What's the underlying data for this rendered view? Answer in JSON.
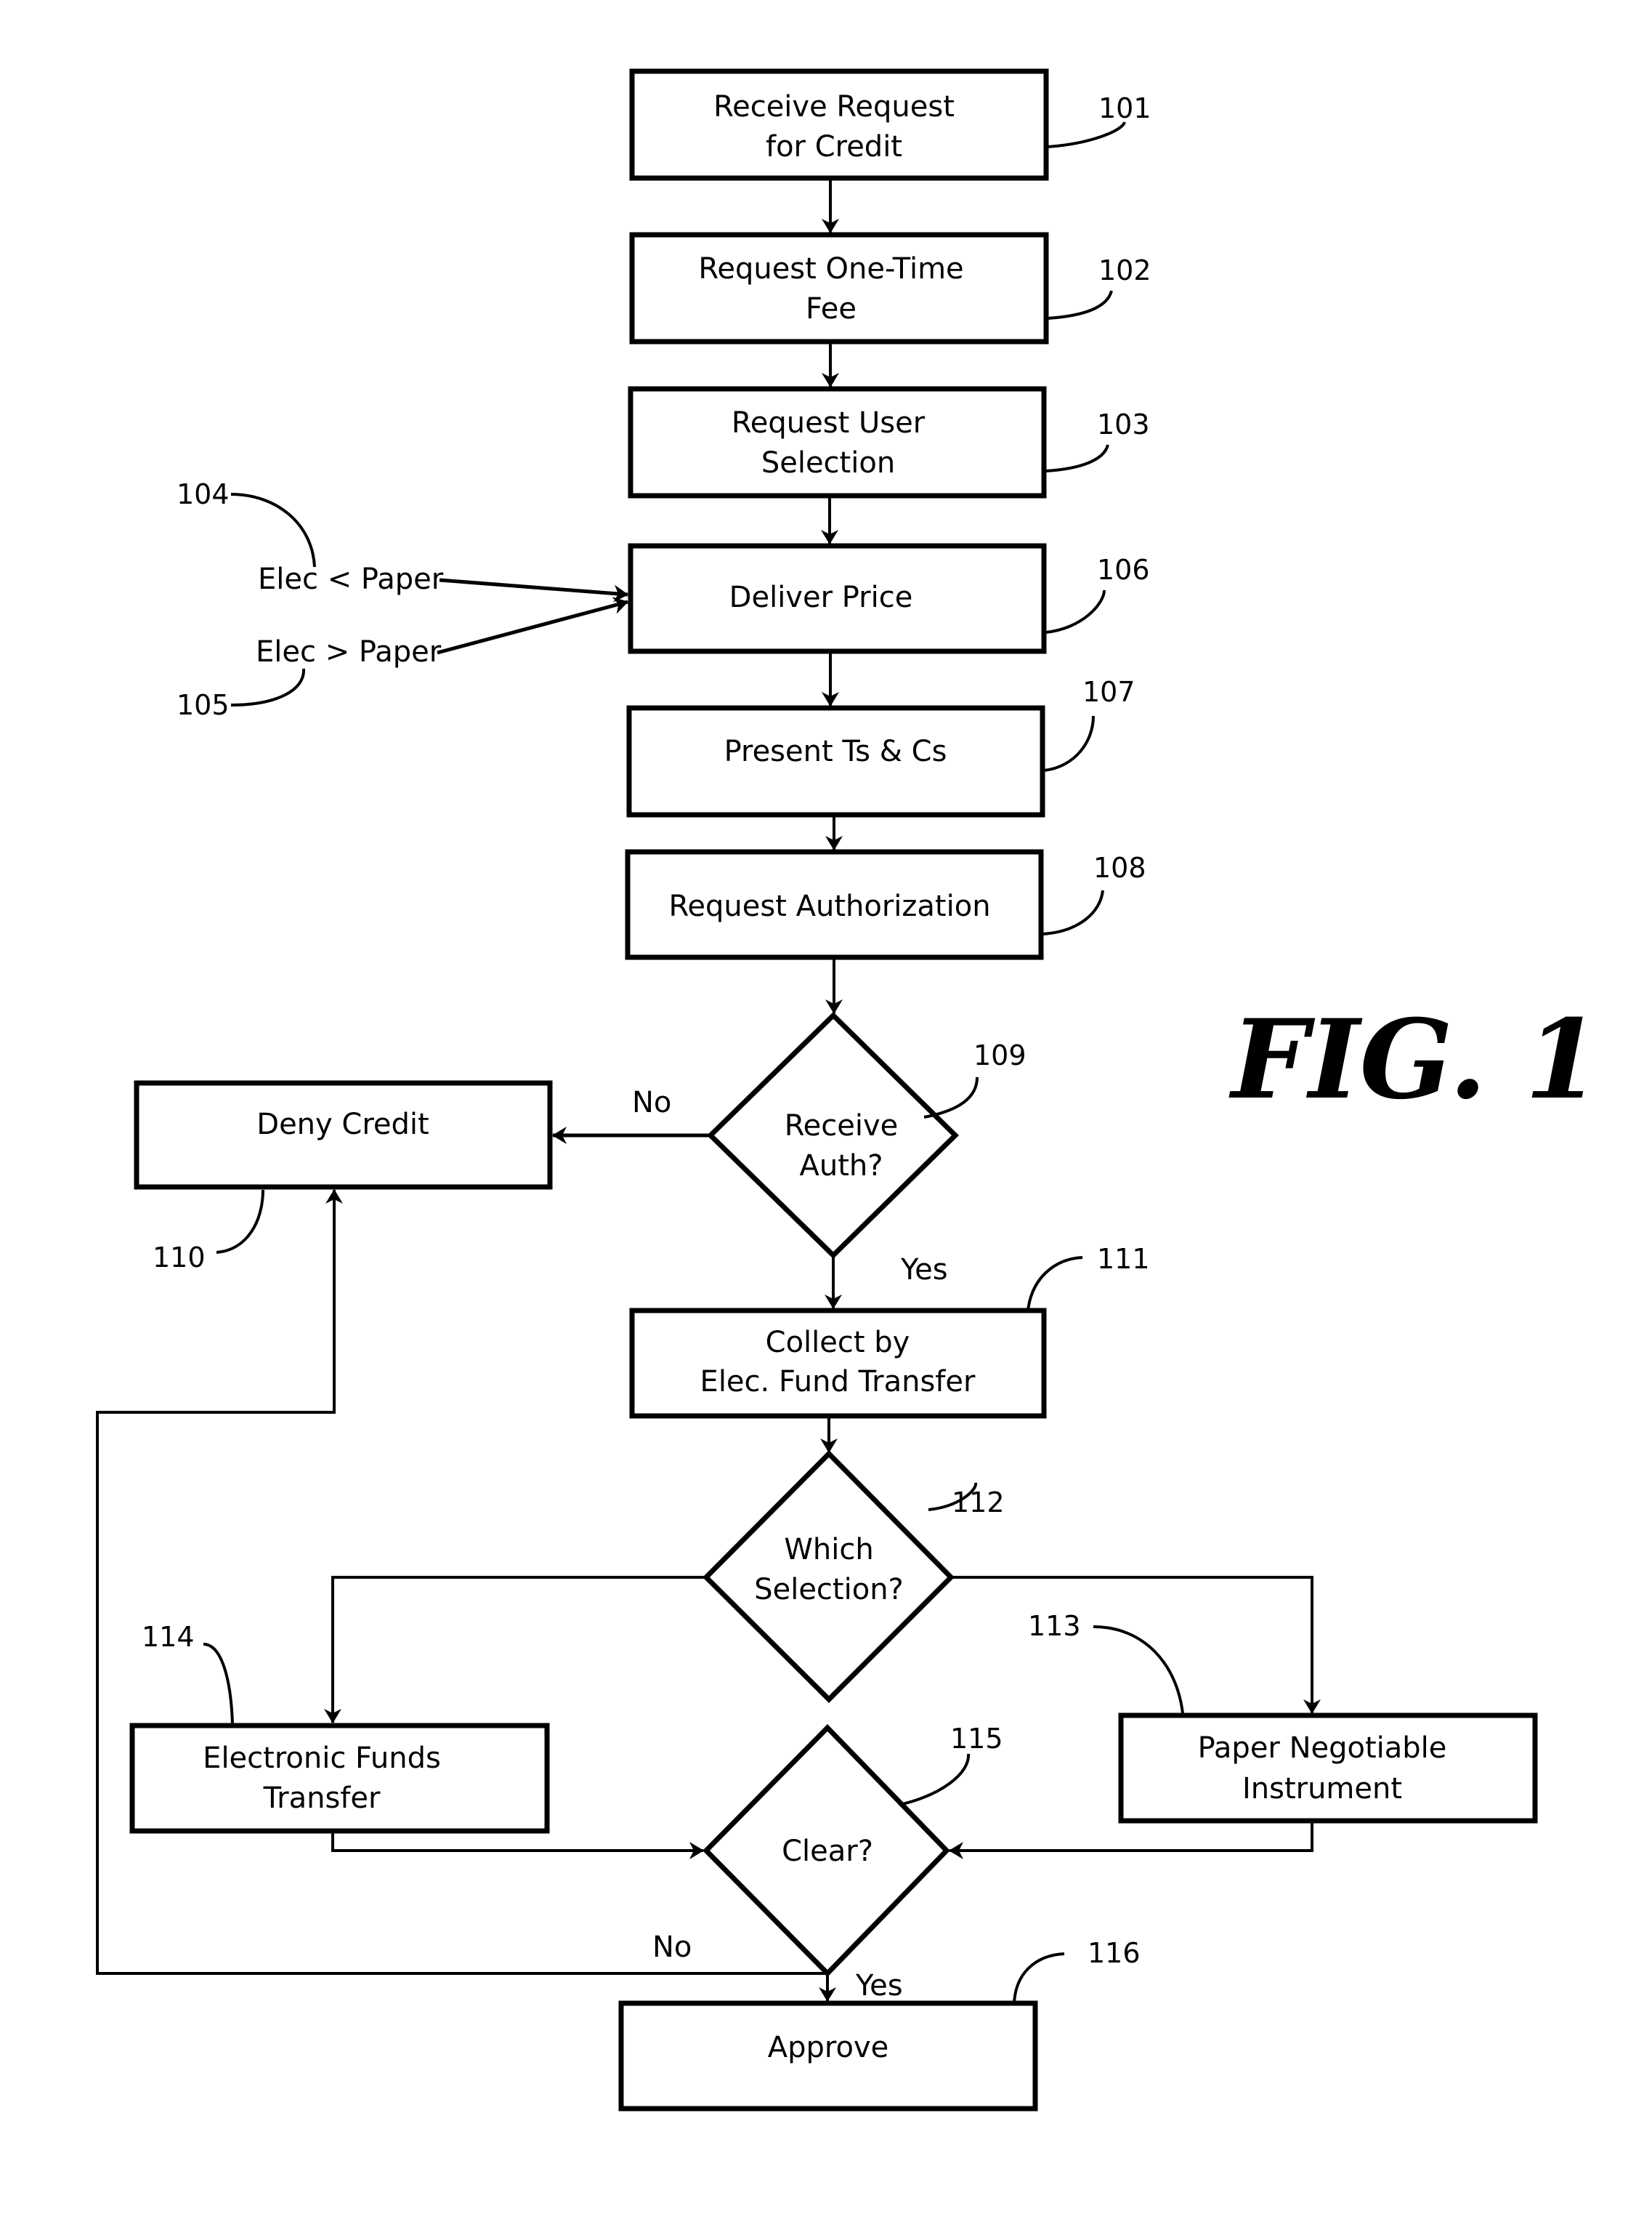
{
  "figure": {
    "title": "FIG. 1"
  },
  "nodes": {
    "n101": {
      "ref": "101",
      "lines": [
        "Receive Request",
        "for Credit"
      ],
      "shape": "process"
    },
    "n102": {
      "ref": "102",
      "lines": [
        "Request One-Time",
        "Fee"
      ],
      "shape": "process"
    },
    "n103": {
      "ref": "103",
      "lines": [
        "Request User",
        "Selection"
      ],
      "shape": "process"
    },
    "n106": {
      "ref": "106",
      "lines": [
        "Deliver Price"
      ],
      "shape": "process"
    },
    "n107": {
      "ref": "107",
      "lines": [
        "Present Ts & Cs"
      ],
      "shape": "process"
    },
    "n108": {
      "ref": "108",
      "lines": [
        "Request Authorization"
      ],
      "shape": "process"
    },
    "n109": {
      "ref": "109",
      "lines": [
        "Receive",
        "Auth?"
      ],
      "shape": "decision"
    },
    "n110": {
      "ref": "110",
      "lines": [
        "Deny Credit"
      ],
      "shape": "process"
    },
    "n111": {
      "ref": "111",
      "lines": [
        "Collect by",
        "Elec. Fund Transfer"
      ],
      "shape": "process"
    },
    "n112": {
      "ref": "112",
      "lines": [
        "Which",
        "Selection?"
      ],
      "shape": "decision"
    },
    "n113": {
      "ref": "113",
      "lines": [
        "Paper Negotiable",
        "Instrument"
      ],
      "shape": "process"
    },
    "n114": {
      "ref": "114",
      "lines": [
        "Electronic Funds",
        "Transfer"
      ],
      "shape": "process"
    },
    "n115": {
      "ref": "115",
      "lines": [
        "Clear?"
      ],
      "shape": "decision"
    },
    "n116": {
      "ref": "116",
      "lines": [
        "Approve"
      ],
      "shape": "process"
    }
  },
  "inputs": {
    "i104": {
      "ref": "104",
      "label": "Elec < Paper"
    },
    "i105": {
      "ref": "105",
      "label": "Elec > Paper"
    }
  },
  "edges": [
    {
      "from": "101",
      "to": "102",
      "label": ""
    },
    {
      "from": "102",
      "to": "103",
      "label": ""
    },
    {
      "from": "103",
      "to": "106",
      "label": ""
    },
    {
      "from": "104",
      "to": "106",
      "label": ""
    },
    {
      "from": "105",
      "to": "106",
      "label": ""
    },
    {
      "from": "106",
      "to": "107",
      "label": ""
    },
    {
      "from": "107",
      "to": "108",
      "label": ""
    },
    {
      "from": "108",
      "to": "109",
      "label": ""
    },
    {
      "from": "109",
      "to": "110",
      "label": "No"
    },
    {
      "from": "109",
      "to": "111",
      "label": "Yes"
    },
    {
      "from": "111",
      "to": "112",
      "label": ""
    },
    {
      "from": "112",
      "to": "114",
      "label": ""
    },
    {
      "from": "112",
      "to": "113",
      "label": ""
    },
    {
      "from": "114",
      "to": "115",
      "label": ""
    },
    {
      "from": "113",
      "to": "115",
      "label": ""
    },
    {
      "from": "115",
      "to": "110",
      "label": "No"
    },
    {
      "from": "115",
      "to": "116",
      "label": "Yes"
    }
  ],
  "edge_labels": {
    "auth_no": "No",
    "auth_yes": "Yes",
    "clear_no": "No",
    "clear_yes": "Yes"
  }
}
